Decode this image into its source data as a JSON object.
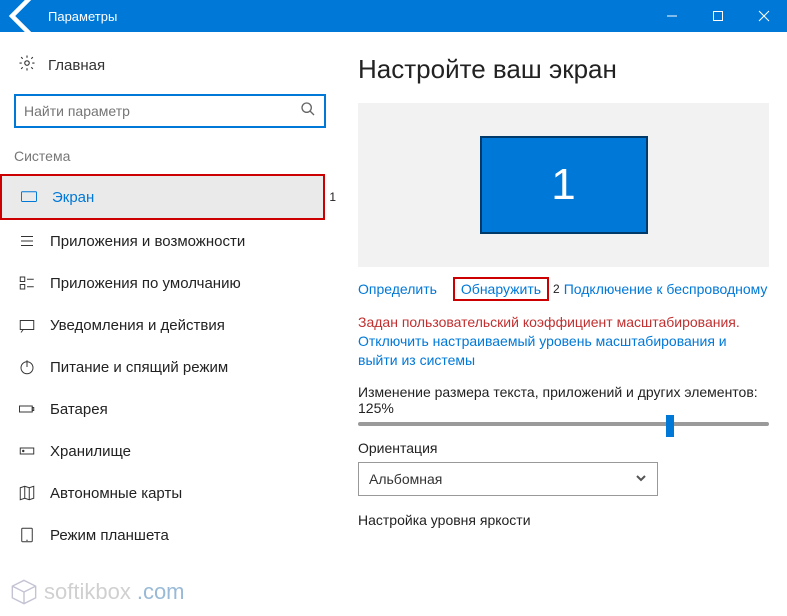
{
  "titlebar": {
    "title": "Параметры"
  },
  "sidebar": {
    "home": "Главная",
    "search_placeholder": "Найти параметр",
    "category": "Система",
    "items": [
      {
        "label": "Экран"
      },
      {
        "label": "Приложения и возможности"
      },
      {
        "label": "Приложения по умолчанию"
      },
      {
        "label": "Уведомления и действия"
      },
      {
        "label": "Питание и спящий режим"
      },
      {
        "label": "Батарея"
      },
      {
        "label": "Хранилище"
      },
      {
        "label": "Автономные карты"
      },
      {
        "label": "Режим планшета"
      }
    ]
  },
  "main": {
    "title": "Настройте ваш экран",
    "monitor_label": "1",
    "links": {
      "identify": "Определить",
      "detect": "Обнаружить",
      "wireless": "Подключение к беспроводному"
    },
    "warning": "Задан пользовательский коэффициент масштабирования.",
    "signout_link": "Отключить настраиваемый уровень масштабирования и выйти из системы",
    "scale_label": "Изменение размера текста, приложений и других элементов: 125%",
    "orientation_label": "Ориентация",
    "orientation_value": "Альбомная",
    "brightness_label": "Настройка уровня яркости"
  },
  "annotations": {
    "one": "1",
    "two": "2"
  },
  "watermark": {
    "text_a": "softikbox",
    "text_b": ".com"
  }
}
